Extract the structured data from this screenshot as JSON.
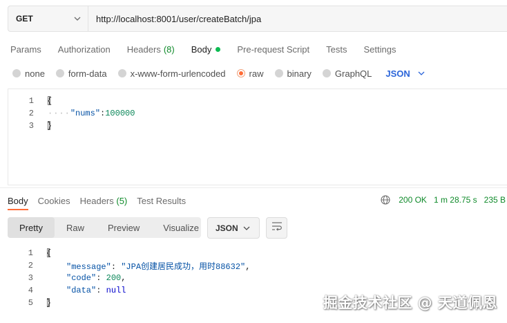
{
  "request": {
    "method": "GET",
    "url": "http://localhost:8001/user/createBatch/jpa"
  },
  "request_tabs": {
    "params": "Params",
    "authorization": "Authorization",
    "headers": "Headers",
    "headers_count": "(8)",
    "body": "Body",
    "pre_request": "Pre-request Script",
    "tests": "Tests",
    "settings": "Settings"
  },
  "body_types": {
    "none": "none",
    "form_data": "form-data",
    "urlencoded": "x-www-form-urlencoded",
    "raw": "raw",
    "binary": "binary",
    "graphql": "GraphQL",
    "format": "JSON",
    "selected": "raw"
  },
  "request_body": {
    "line_numbers": [
      "1",
      "2",
      "3"
    ],
    "open_brace": "{",
    "indent_dots": "····",
    "key": "\"nums\"",
    "colon": ":",
    "value": "100000",
    "close_brace": "}"
  },
  "response_tabs": {
    "body": "Body",
    "cookies": "Cookies",
    "headers": "Headers",
    "headers_count": "(5)",
    "test_results": "Test Results"
  },
  "response_status": {
    "status": "200 OK",
    "time": "1 m 28.75 s",
    "size": "235 B"
  },
  "response_view": {
    "pretty": "Pretty",
    "raw": "Raw",
    "preview": "Preview",
    "visualize": "Visualize",
    "format": "JSON"
  },
  "response_body": {
    "line_numbers": [
      "1",
      "2",
      "3",
      "4",
      "5"
    ],
    "open_brace": "{",
    "message_key": "\"message\"",
    "message_value": "\"JPA创建居民成功，用时88632\"",
    "code_key": "\"code\"",
    "code_value": "200",
    "data_key": "\"data\"",
    "data_value": "null",
    "close_brace": "}"
  },
  "watermark": "掘金技术社区 @ 天道佩恩",
  "colors": {
    "accent_orange": "#ff6c37",
    "status_green": "#0f8a2a",
    "json_blue": "#2b65d9"
  }
}
